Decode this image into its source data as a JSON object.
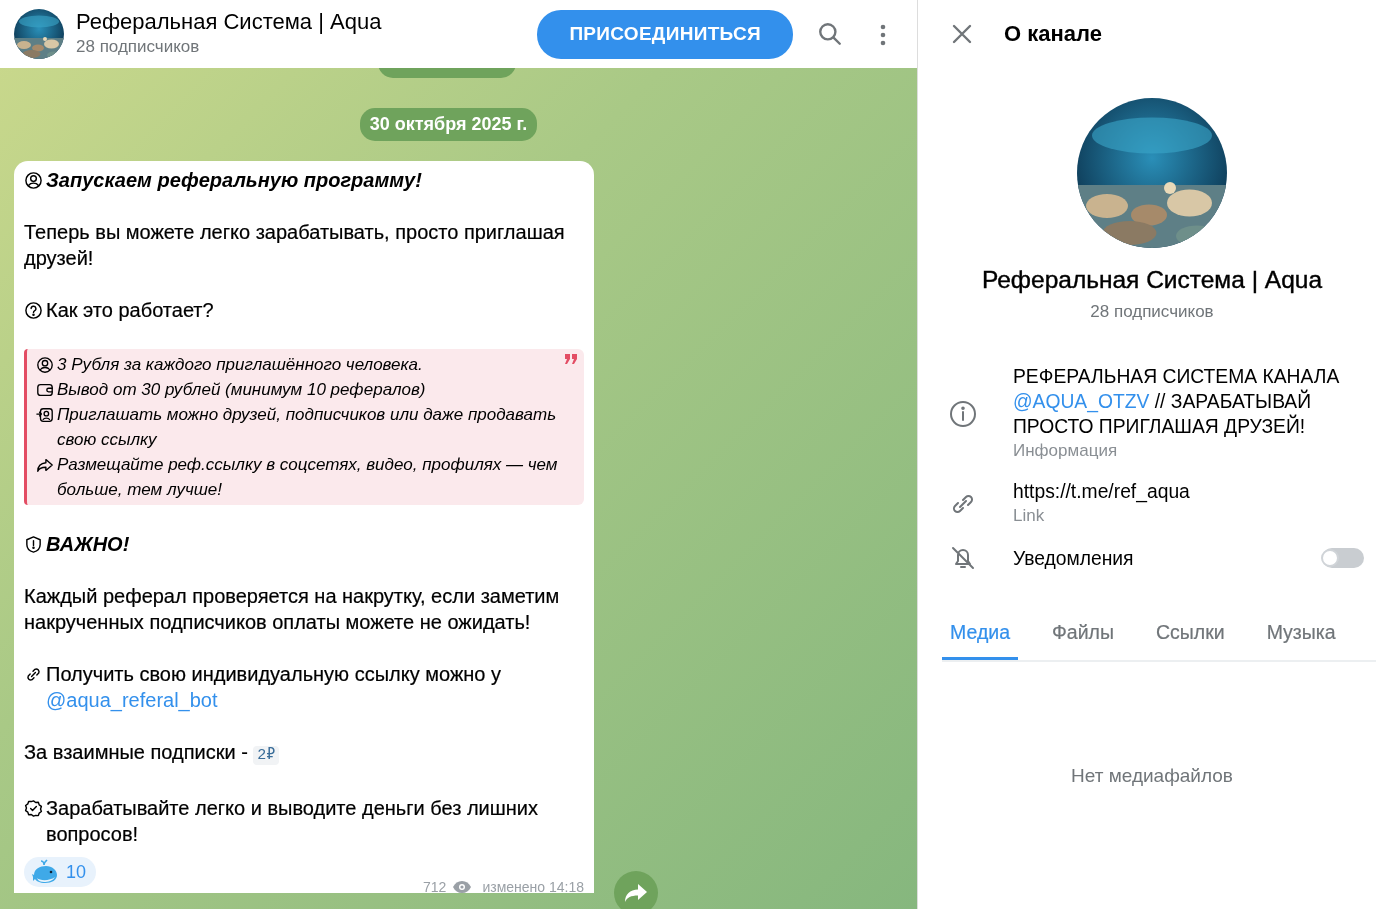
{
  "header": {
    "title": "Реферальная Система | Aqua",
    "subtitle": "28 подписчиков",
    "join_button": "ПРИСОЕДИНИТЬСЯ"
  },
  "date_pill": "30 октября 2025 г.",
  "message": {
    "blocks": [
      {
        "kind": "heading",
        "text": "Запускаем реферальную программу!"
      },
      {
        "kind": "text",
        "text": "Теперь вы можете легко зарабатывать, просто приглашая друзей!"
      },
      {
        "kind": "text",
        "text": "Как это работает?"
      },
      {
        "kind": "quote",
        "items": [
          {
            "text": "3 Рубля за каждого приглашённого человека."
          },
          {
            "text": "Вывод от 30 рублей (минимум 10 рефералов)"
          },
          {
            "text": "Приглашать можно друзей, подписчиков или даже продавать свою ссылку"
          },
          {
            "text": "Размещайте реф.ссылку в соцсетях, видео, профилях — чем больше, тем лучше!"
          }
        ]
      },
      {
        "kind": "heading",
        "text": "ВАЖНО!"
      },
      {
        "kind": "text",
        "text": "Каждый реферал проверяется на накрутку, если заметим накрученных подписчиков оплаты можете не ожидать!"
      },
      {
        "kind": "text",
        "text": "Получить свою индивидуальную ссылку можно у ",
        "link": "@aqua_referal_bot"
      },
      {
        "kind": "text",
        "text": "За взаимные подписки - ",
        "code": "2₽"
      },
      {
        "kind": "text",
        "text": "Зарабатывайте легко и выводите деньги без лишних вопросов!"
      }
    ],
    "reactions": [
      {
        "count": "10"
      }
    ],
    "views": "712",
    "edited": "изменено 14:18"
  },
  "panel": {
    "title": "О канале",
    "name": "Реферальная Система | Aqua",
    "subtitle": "28 подписчиков",
    "info": [
      {
        "kind": "description",
        "parts": [
          {
            "kind": "text",
            "text": "РЕФЕРАЛЬНАЯ СИСТЕМА КАНАЛА "
          },
          {
            "kind": "link",
            "text": "@AQUA_OTZV"
          },
          {
            "kind": "text",
            "text": " // ЗАРАБАТЫВАЙ ПРОСТО ПРИГЛАШАЯ ДРУЗЕЙ!"
          }
        ],
        "caption": "Информация"
      },
      {
        "kind": "link",
        "value": "https://t.me/ref_aqua",
        "caption": "Link"
      },
      {
        "kind": "toggle",
        "label": "Уведомления",
        "on": false
      }
    ],
    "tabs": [
      {
        "label": "Медиа",
        "selected": true
      },
      {
        "label": "Файлы",
        "selected": false
      },
      {
        "label": "Ссылки",
        "selected": false
      },
      {
        "label": "Музыка",
        "selected": false
      }
    ],
    "empty_text": "Нет медиафайлов"
  }
}
